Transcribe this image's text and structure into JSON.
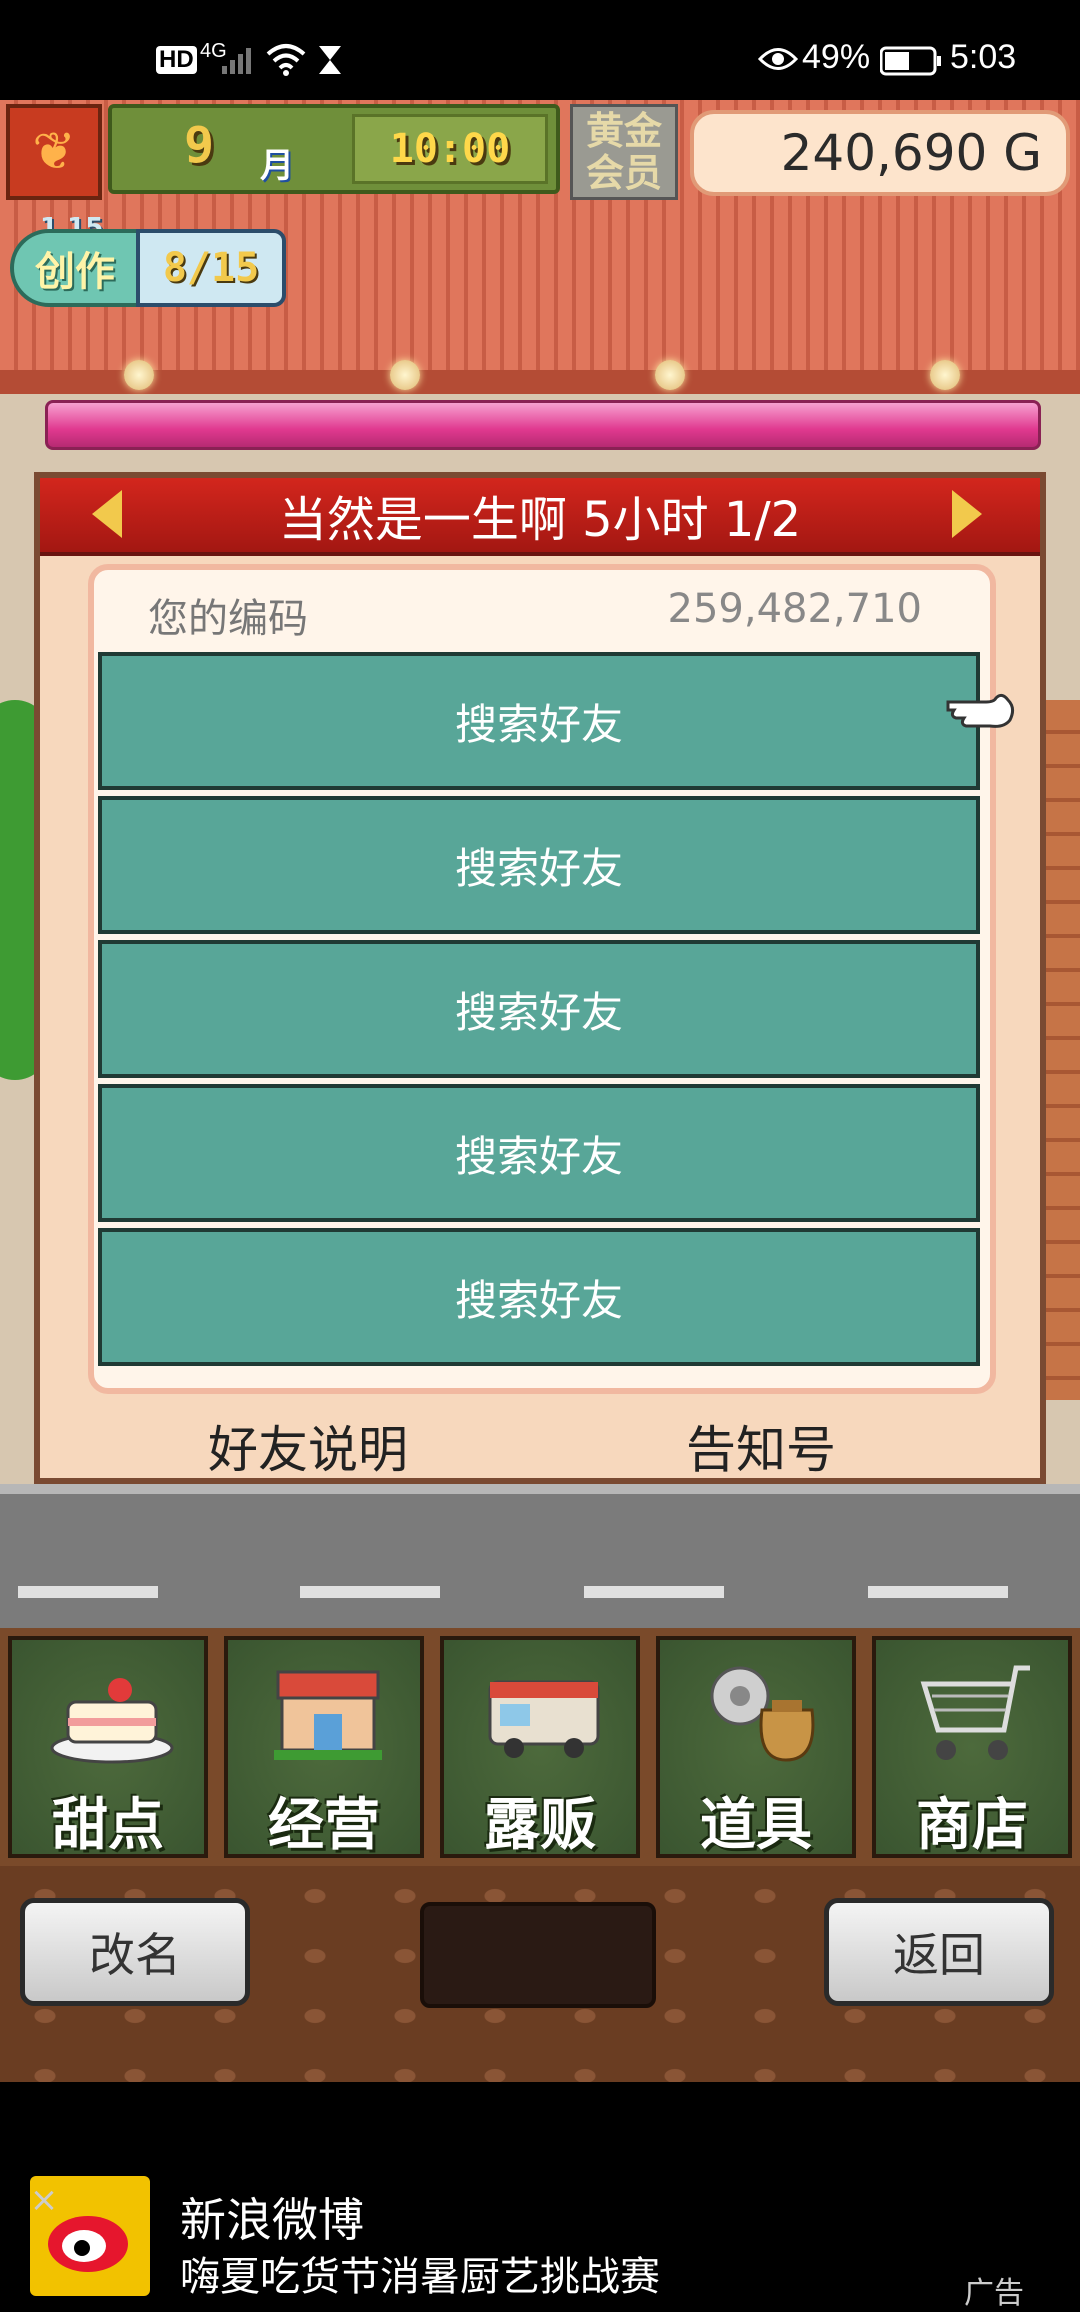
{
  "status_bar": {
    "left_icons": [
      "HD",
      "4G",
      "signal-icon",
      "wifi-icon",
      "hourglass-icon"
    ],
    "eye_icon": "eye-icon",
    "battery": "49%",
    "time": "5:03"
  },
  "hud": {
    "month_number": "9",
    "month_label": "月",
    "time": "10:00",
    "member_line1": "黄金",
    "member_line2": "会员",
    "gold": "240,690 G",
    "create_label": "创作",
    "create_level": "1 15",
    "create_value": "8/15"
  },
  "dialog": {
    "title": "当然是一生啊  5小时 1/2",
    "code_label": "您的编码",
    "code_value": "259,482,710",
    "friend_buttons": [
      "搜索好友",
      "搜索好友",
      "搜索好友",
      "搜索好友",
      "搜索好友"
    ],
    "help_link": "好友说明",
    "notice_link": "告知号"
  },
  "menu": [
    {
      "label": "甜点",
      "icon": "cake-icon"
    },
    {
      "label": "经营",
      "icon": "shop-building-icon"
    },
    {
      "label": "露贩",
      "icon": "food-truck-icon"
    },
    {
      "label": "道具",
      "icon": "items-bag-icon"
    },
    {
      "label": "商店",
      "icon": "shopping-cart-icon"
    }
  ],
  "controls": {
    "rename": "改名",
    "back": "返回"
  },
  "ad": {
    "app_name": "新浪微博",
    "subtitle": "嗨夏吃货节消暑厨艺挑战赛",
    "tag": "广告"
  }
}
